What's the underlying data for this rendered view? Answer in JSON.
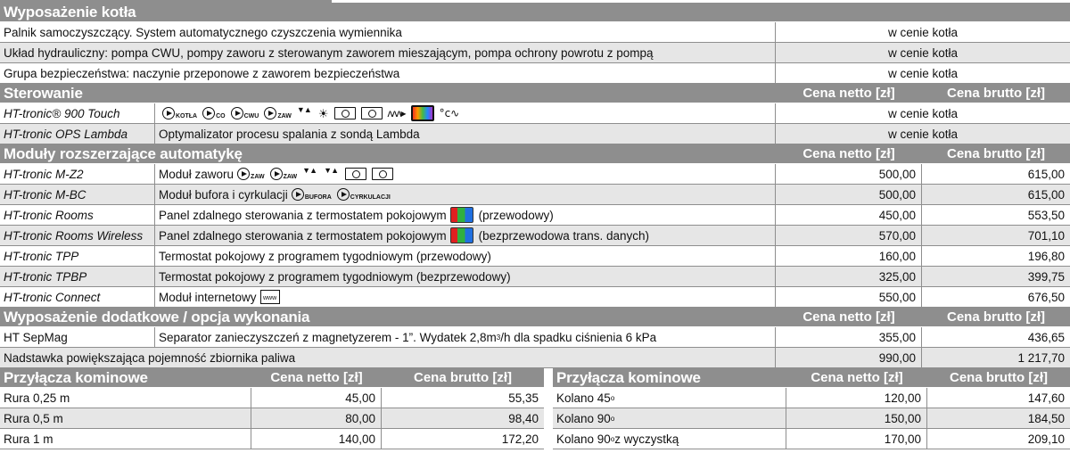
{
  "sec_boiler": {
    "title": "Wyposażenie kotła",
    "rows": [
      {
        "desc": "Palnik  samoczyszczący. System automatycznego czyszczenia wymiennika",
        "price": "w cenie kotła"
      },
      {
        "desc": "Układ hydrauliczny: pompa CWU, pompy zaworu z sterowanym zaworem mieszającym, pompa ochrony powrotu z pompą",
        "price": "w cenie kotła"
      },
      {
        "desc": "Grupa bezpieczeństwa: naczynie przeponowe z zaworem bezpieczeństwa",
        "price": "w cenie kotła"
      }
    ]
  },
  "sec_control": {
    "title": "Sterowanie",
    "netto_h": "Cena netto [zł]",
    "brutto_h": "Cena brutto [zł]",
    "rows": [
      {
        "name": "HT-tronic® 900 Touch",
        "icon_labels": [
          "KOTŁA",
          "CO",
          "CWU",
          "ZAW"
        ],
        "price": "w cenie kotła"
      },
      {
        "name": "HT-tronic OPS Lambda",
        "desc": "Optymalizator procesu spalania z sondą Lambda",
        "price": "w cenie kotła"
      }
    ]
  },
  "sec_modules": {
    "title": "Moduły rozszerzające automatykę",
    "netto_h": "Cena netto [zł]",
    "brutto_h": "Cena brutto [zł]",
    "rows": [
      {
        "name": "HT-tronic M-Z2",
        "desc": "Moduł zaworu",
        "icon_labels": [
          "ZAW",
          "ZAW"
        ],
        "netto": "500,00",
        "brutto": "615,00"
      },
      {
        "name": "HT-tronic M-BC",
        "desc": "Moduł bufora i cyrkulacji",
        "icon_labels": [
          "BUFORA",
          "CYRKULACJI"
        ],
        "netto": "500,00",
        "brutto": "615,00"
      },
      {
        "name": "HT-tronic Rooms",
        "desc": "Panel zdalnego sterowania z termostatem pokojowym",
        "suffix": "(przewodowy)",
        "netto": "450,00",
        "brutto": "553,50"
      },
      {
        "name": "HT-tronic Rooms Wireless",
        "desc": "Panel zdalnego sterowania z termostatem pokojowym",
        "suffix": "(bezprzewodowa trans. danych)",
        "netto": "570,00",
        "brutto": "701,10"
      },
      {
        "name": "HT-tronic TPP",
        "desc": "Termostat pokojowy z programem tygodniowym (przewodowy)",
        "netto": "160,00",
        "brutto": "196,80"
      },
      {
        "name": "HT-tronic TPBP",
        "desc": "Termostat pokojowy z programem tygodniowym (bezprzewodowy)",
        "netto": "325,00",
        "brutto": "399,75"
      },
      {
        "name": "HT-tronic Connect",
        "desc": "Moduł internetowy",
        "icon_label": "www",
        "netto": "550,00",
        "brutto": "676,50"
      }
    ]
  },
  "sec_extra": {
    "title": "Wyposażenie dodatkowe / opcja wykonania",
    "netto_h": "Cena netto [zł]",
    "brutto_h": "Cena brutto [zł]",
    "row1": {
      "name": "HT SepMag",
      "desc_a": "Separator zanieczyszczeń z magnetyzerem - 1”. Wydatek 2,8m",
      "desc_sup": "3",
      "desc_b": "/h dla spadku ciśnienia 6 kPa",
      "netto": "355,00",
      "brutto": "436,65"
    },
    "row2": {
      "desc": "Nadstawka powiększająca pojemność zbiornika paliwa",
      "netto": "990,00",
      "brutto": "1 217,70"
    }
  },
  "chimney_left": {
    "title": "Przyłącza kominowe",
    "netto_h": "Cena netto [zł]",
    "brutto_h": "Cena brutto [zł]",
    "rows": [
      {
        "name": "Rura 0,25 m",
        "netto": "45,00",
        "brutto": "55,35"
      },
      {
        "name": "Rura 0,5 m",
        "netto": "80,00",
        "brutto": "98,40"
      },
      {
        "name": "Rura 1 m",
        "netto": "140,00",
        "brutto": "172,20"
      }
    ]
  },
  "chimney_right": {
    "title": "Przyłącza kominowe",
    "netto_h": "Cena netto [zł]",
    "brutto_h": "Cena brutto [zł]",
    "rows": [
      {
        "name_a": "Kolano 45",
        "deg": "o",
        "name_b": "",
        "netto": "120,00",
        "brutto": "147,60"
      },
      {
        "name_a": "Kolano 90",
        "deg": "o",
        "name_b": "",
        "netto": "150,00",
        "brutto": "184,50"
      },
      {
        "name_a": "Kolano 90",
        "deg": "o",
        "name_b": " z wyczystką",
        "netto": "170,00",
        "brutto": "209,10"
      }
    ]
  }
}
